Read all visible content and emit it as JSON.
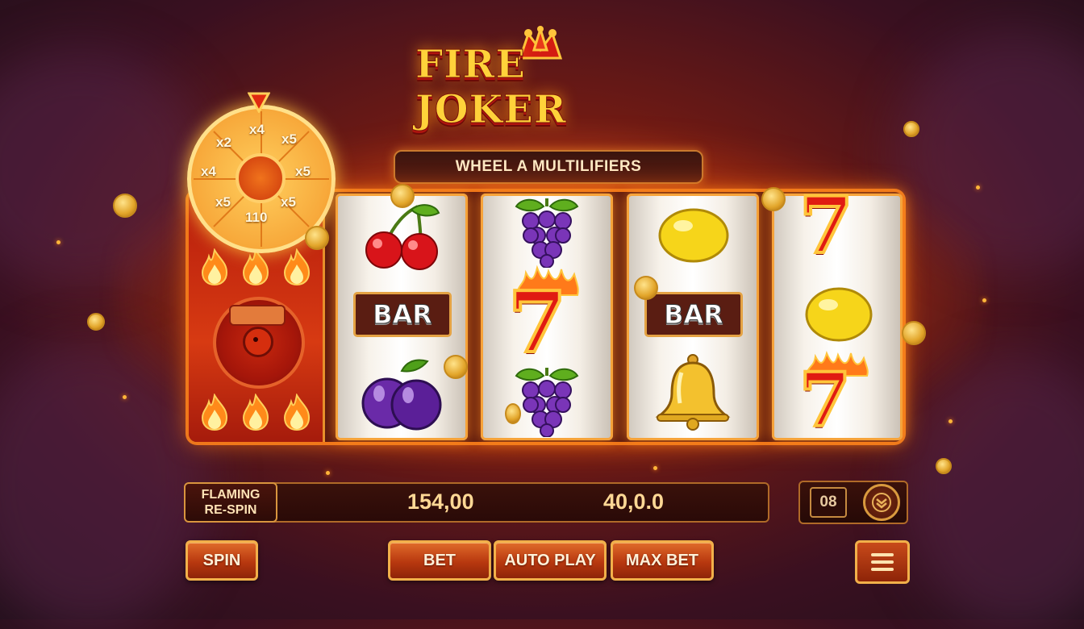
{
  "game": {
    "title": "FIRE JOKER",
    "banner": "WHEEL A MULTILIFIERS"
  },
  "wheel": {
    "segments": [
      "x4",
      "x2",
      "x5",
      "x5",
      "110",
      "x5",
      "x4",
      "x2"
    ]
  },
  "reels": [
    [
      "cherries",
      "bar",
      "plums"
    ],
    [
      "grapes",
      "seven",
      "grapes"
    ],
    [
      "lemon",
      "bar",
      "bell"
    ],
    [
      "seven",
      "lemon",
      "seven"
    ]
  ],
  "symbols": {
    "bar_label": "BAR",
    "seven_label": "7"
  },
  "status": {
    "feature_label_line1": "FLAMING",
    "feature_label_line2": "RE-SPIN",
    "balance": "154,00",
    "win": "40,0.0",
    "counter": "08"
  },
  "buttons": {
    "spin": "SPIN",
    "bet": "BET",
    "auto_play": "AUTO PLAY",
    "max_bet": "MAX BET"
  },
  "colors": {
    "accent_gold": "#f2b04a",
    "seven_red": "#e01b12",
    "panel_red": "#b61d0d"
  }
}
